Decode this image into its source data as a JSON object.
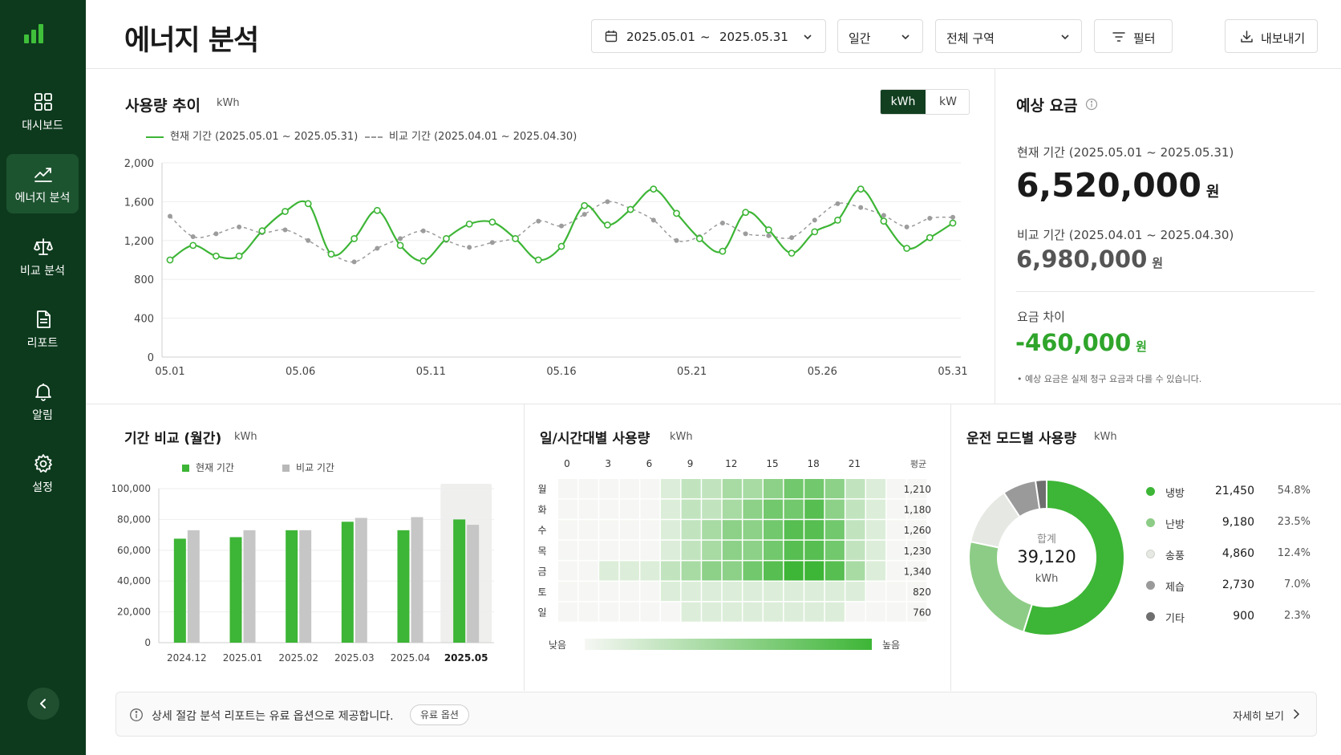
{
  "sidebar": {
    "items": [
      {
        "label": "대시보드",
        "icon": "grid-icon"
      },
      {
        "label": "에너지 분석",
        "icon": "trend-icon"
      },
      {
        "label": "비교 분석",
        "icon": "scale-icon"
      },
      {
        "label": "리포트",
        "icon": "document-icon"
      },
      {
        "label": "알림",
        "icon": "bell-icon"
      },
      {
        "label": "설정",
        "icon": "gear-icon"
      }
    ],
    "active": "에너지 분석"
  },
  "header": {
    "title": "에너지 분석",
    "date_start": "2025.05.01",
    "date_sep": "~",
    "date_end": "2025.05.31",
    "period_select": "일간",
    "zone_select": "전체 구역",
    "filter_label": "필터",
    "export_label": "내보내기"
  },
  "trend": {
    "title": "사용량 추이",
    "unit": "kWh",
    "toggle": [
      "kWh",
      "kW"
    ],
    "legend_current": "현재 기간 (2025.05.01 ~ 2025.05.31)",
    "legend_compare": "비교 기간 (2025.04.01 ~ 2025.04.30)"
  },
  "cost": {
    "title": "예상 요금",
    "current_label": "현재 기간 (2025.05.01 ~ 2025.05.31)",
    "current_value": "6,520,000",
    "compare_label": "비교 기간 (2025.04.01 ~ 2025.04.30)",
    "compare_value": "6,980,000",
    "diff_label": "요금 차이",
    "diff_value": "-460,000",
    "currency": "원",
    "note": "• 예상 요금은 실제 청구 요금과 다를 수 있습니다."
  },
  "period_compare": {
    "title": "기간 비교 (월간)",
    "unit": "kWh",
    "legend_current": "현재 기간",
    "legend_compare": "비교 기간"
  },
  "heatmap": {
    "title": "일/시간대별 사용량",
    "unit": "kWh",
    "avg_label": "평균",
    "low_label": "낮음",
    "high_label": "높음"
  },
  "mode": {
    "title": "운전 모드별 사용량",
    "unit": "kWh",
    "total_label": "합계",
    "total_value": "39,120",
    "total_unit": "kWh"
  },
  "banner": {
    "message": "상세 절감 분석 리포트는 유료 옵션으로 제공합니다.",
    "badge": "유료 옵션",
    "more": "자세히 보기"
  },
  "colors": {
    "sidebar": "#0d3a1d",
    "accent": "#3db536",
    "negative_green": "#2fa52b",
    "compare_gray": "#c6c6c6"
  },
  "chart_data": [
    {
      "type": "line",
      "title": "사용량 추이",
      "ylabel": "kWh",
      "ylim": [
        0,
        2000
      ],
      "yticks": [
        0,
        400,
        800,
        1200,
        1600,
        2000
      ],
      "x": [
        "05.01",
        "05.02",
        "05.03",
        "05.04",
        "05.05",
        "05.06",
        "05.07",
        "05.08",
        "05.09",
        "05.10",
        "05.11",
        "05.12",
        "05.13",
        "05.14",
        "05.15",
        "05.16",
        "05.17",
        "05.18",
        "05.19",
        "05.20",
        "05.21",
        "05.22",
        "05.23",
        "05.24",
        "05.25",
        "05.26",
        "05.27",
        "05.28",
        "05.29",
        "05.30",
        "05.31"
      ],
      "xticks": [
        "05.01",
        "05.06",
        "05.11",
        "05.16",
        "05.21",
        "05.26",
        "05.31"
      ],
      "grid": true,
      "series": [
        {
          "name": "현재 기간 (2025.05.01 ~ 2025.05.31)",
          "values": [
            1000,
            1150,
            1040,
            1040,
            1300,
            1500,
            1580,
            1060,
            1220,
            1510,
            1150,
            990,
            1220,
            1370,
            1390,
            1220,
            1000,
            1140,
            1560,
            1360,
            1520,
            1730,
            1480,
            1220,
            1090,
            1490,
            1310,
            1070,
            1290,
            1410,
            1730,
            1400,
            1120,
            1230,
            1380
          ]
        },
        {
          "name": "비교 기간 (2025.04.01 ~ 2025.04.30)",
          "values": [
            1450,
            1240,
            1270,
            1340,
            1280,
            1310,
            1200,
            1060,
            980,
            1120,
            1220,
            1300,
            1200,
            1130,
            1180,
            1230,
            1400,
            1350,
            1470,
            1600,
            1530,
            1410,
            1200,
            1240,
            1380,
            1270,
            1250,
            1230,
            1410,
            1580,
            1540,
            1460,
            1340,
            1430,
            1440
          ]
        }
      ]
    },
    {
      "type": "bar",
      "title": "기간 비교 (월간)",
      "ylabel": "kWh",
      "ylim": [
        0,
        100000
      ],
      "yticks": [
        0,
        20000,
        40000,
        60000,
        80000,
        100000
      ],
      "categories": [
        "2024.12",
        "2025.01",
        "2025.02",
        "2025.03",
        "2025.04",
        "2025.05"
      ],
      "highlighted_category": "2025.05",
      "series": [
        {
          "name": "현재 기간",
          "values": [
            67500,
            68500,
            73000,
            78500,
            73000,
            80000
          ]
        },
        {
          "name": "비교 기간",
          "values": [
            73000,
            73000,
            73000,
            81000,
            81500,
            76500
          ]
        }
      ]
    },
    {
      "type": "heatmap",
      "title": "일/시간대별 사용량",
      "x_ticks": [
        "0",
        "3",
        "6",
        "9",
        "12",
        "15",
        "18",
        "21"
      ],
      "rows": [
        "월",
        "화",
        "수",
        "목",
        "금",
        "토",
        "일"
      ],
      "row_averages": [
        "1,210",
        "1,180",
        "1,260",
        "1,230",
        "1,340",
        "820",
        "760"
      ],
      "levels": [
        [
          1,
          1,
          1,
          1,
          1,
          2,
          3,
          3,
          4,
          4,
          5,
          6,
          6,
          5,
          3,
          2,
          1,
          1
        ],
        [
          1,
          1,
          1,
          1,
          1,
          2,
          3,
          3,
          4,
          5,
          6,
          6,
          7,
          5,
          3,
          2,
          1,
          1
        ],
        [
          1,
          1,
          1,
          1,
          1,
          2,
          3,
          4,
          5,
          5,
          6,
          7,
          7,
          6,
          3,
          2,
          1,
          1
        ],
        [
          1,
          1,
          1,
          1,
          1,
          2,
          3,
          4,
          5,
          5,
          6,
          7,
          7,
          6,
          3,
          2,
          1,
          1
        ],
        [
          1,
          1,
          2,
          2,
          2,
          3,
          4,
          5,
          5,
          6,
          7,
          8,
          8,
          7,
          4,
          2,
          1,
          1
        ],
        [
          1,
          1,
          1,
          1,
          1,
          2,
          2,
          2,
          2,
          2,
          2,
          2,
          2,
          2,
          2,
          1,
          1,
          1
        ],
        [
          1,
          1,
          1,
          1,
          1,
          1,
          2,
          2,
          2,
          2,
          2,
          2,
          2,
          2,
          1,
          1,
          1,
          1
        ]
      ]
    },
    {
      "type": "pie",
      "title": "운전 모드별 사용량",
      "total": 39120,
      "slices": [
        {
          "name": "냉방",
          "value": 21450,
          "value_text": "21,450",
          "percent": "54.8%",
          "color": "#3db536"
        },
        {
          "name": "난방",
          "value": 9180,
          "value_text": "9,180",
          "percent": "23.5%",
          "color": "#8dcc86"
        },
        {
          "name": "송풍",
          "value": 4860,
          "value_text": "4,860",
          "percent": "12.4%",
          "color": "#e6e9e3"
        },
        {
          "name": "제습",
          "value": 2730,
          "value_text": "2,730",
          "percent": "7.0%",
          "color": "#9a9a9a"
        },
        {
          "name": "기타",
          "value": 900,
          "value_text": "900",
          "percent": "2.3%",
          "color": "#6f6f6f"
        }
      ]
    }
  ]
}
